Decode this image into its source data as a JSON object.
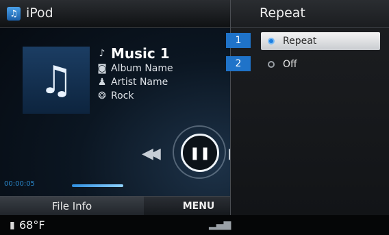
{
  "header": {
    "app_icon": "music-note-icon",
    "title": "iPod"
  },
  "now_playing": {
    "title": "Music 1",
    "album": "Album Name",
    "artist": "Artist Name",
    "genre": "Rock",
    "elapsed_time": "00:00:05",
    "progress_fraction": 0.2
  },
  "controls": {
    "prev": "previous-track-icon",
    "play_pause": "pause-icon",
    "next": "next-track-icon"
  },
  "tabs": {
    "file_info": "File Info",
    "menu": "MENU"
  },
  "status": {
    "temperature": "68°F"
  },
  "popup": {
    "title": "Repeat",
    "options": [
      {
        "label": "Repeat",
        "selected": true
      },
      {
        "label": "Off",
        "selected": false
      }
    ]
  },
  "callouts": [
    "1",
    "2"
  ],
  "colors": {
    "accent": "#1f7fe0",
    "callout_bg": "#1f73c9"
  }
}
